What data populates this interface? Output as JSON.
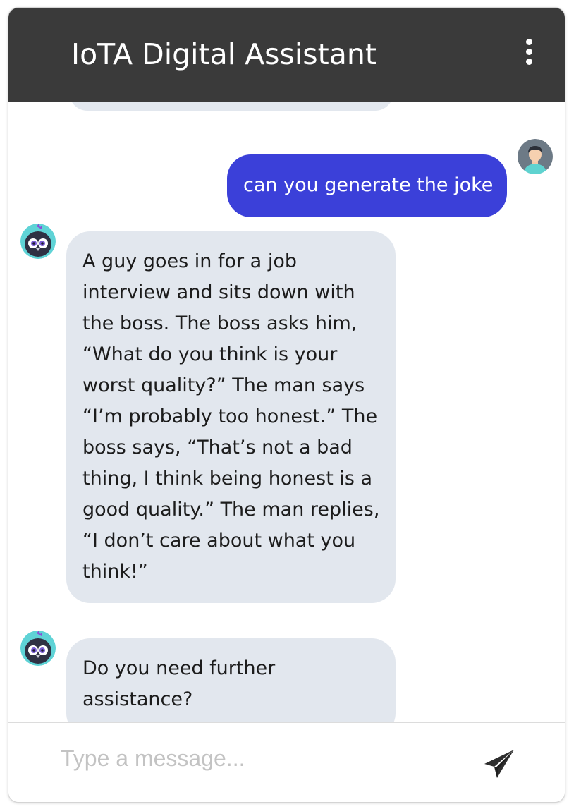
{
  "header": {
    "title": "IoTA Digital Assistant",
    "menu_icon": "more-vertical-icon"
  },
  "messages": [
    {
      "sender": "user",
      "text": "can you generate the joke"
    },
    {
      "sender": "bot",
      "lines": [
        "A guy goes in for a job",
        "interview and sits down with",
        "the boss. The boss asks him,",
        "“What do you think is your",
        "worst quality?” The man says",
        "“I’m probably too honest.” The",
        "boss says, “That’s not a bad",
        "thing, I think being honest is a",
        "good quality.” The man replies,",
        "“I don’t care about what you",
        "think!”"
      ]
    },
    {
      "sender": "bot",
      "lines": [
        "Do you need further",
        "assistance?"
      ]
    }
  ],
  "composer": {
    "placeholder": "Type a message...",
    "send_icon": "send-paper-plane-icon"
  },
  "colors": {
    "header_bg": "#3a3a3a",
    "user_bubble": "#3b40d9",
    "bot_bubble": "#e2e7ee"
  }
}
